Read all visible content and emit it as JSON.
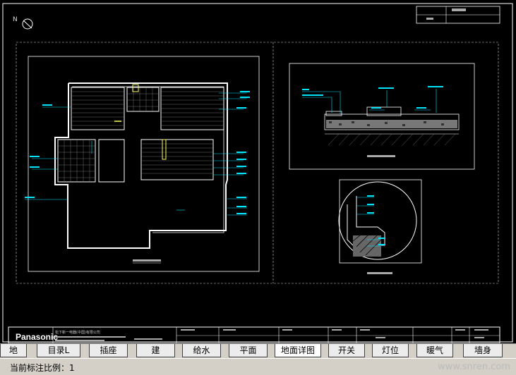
{
  "drawing": {
    "north_label": "N",
    "title_block": {
      "brand": "Panasonic",
      "company_line": "松下新一电器(中国)有限公司"
    }
  },
  "tabs": [
    {
      "label": "地",
      "active": false
    },
    {
      "label": "目录L",
      "active": false
    },
    {
      "label": "插座",
      "active": false
    },
    {
      "label": "建",
      "active": false
    },
    {
      "label": "给水",
      "active": false
    },
    {
      "label": "平面",
      "active": false
    },
    {
      "label": "地面详图",
      "active": true
    },
    {
      "label": "开关",
      "active": false
    },
    {
      "label": "灯位",
      "active": false
    },
    {
      "label": "暖气",
      "active": false
    },
    {
      "label": "墙身",
      "active": false
    }
  ],
  "status": {
    "scale_text": "当前标注比例：1",
    "watermark": "www.snren.com"
  },
  "colors": {
    "canvas": "#000000",
    "linework": "#ffffff",
    "annotation": "#00e5ff",
    "accent": "#ffff66"
  }
}
